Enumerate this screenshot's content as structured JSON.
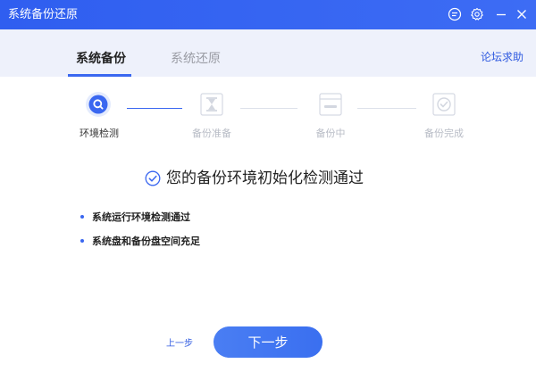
{
  "window": {
    "title": "系统备份还原"
  },
  "tabs": {
    "backup": "系统备份",
    "restore": "系统还原"
  },
  "help_link": "论坛求助",
  "steps": [
    {
      "label": "环境检测",
      "state": "active",
      "icon": "search-icon"
    },
    {
      "label": "备份准备",
      "state": "pending",
      "icon": "hourglass-icon"
    },
    {
      "label": "备份中",
      "state": "pending",
      "icon": "progress-icon"
    },
    {
      "label": "备份完成",
      "state": "pending",
      "icon": "check-shield-icon"
    }
  ],
  "result": {
    "message": "您的备份环境初始化检测通过"
  },
  "checks": [
    "系统运行环境检测通过",
    "系统盘和备份盘空间充足"
  ],
  "nav": {
    "prev": "上一步",
    "next": "下一步"
  },
  "colors": {
    "accent": "#3a67f0",
    "titlebar": "#2f5ef0",
    "tabbar_bg": "#eef1fb",
    "inactive": "#b8bcc6"
  }
}
